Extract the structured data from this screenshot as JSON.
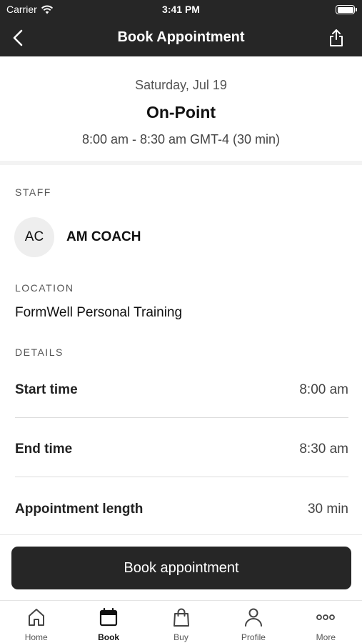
{
  "status_bar": {
    "carrier": "Carrier",
    "time": "3:41 PM"
  },
  "nav": {
    "title": "Book Appointment",
    "back_icon": "chevron-left-icon",
    "share_icon": "share-icon"
  },
  "header": {
    "date": "Saturday, Jul 19",
    "title": "On-Point",
    "time_range": "8:00 am - 8:30 am GMT-4 (30 min)"
  },
  "staff": {
    "label": "STAFF",
    "initials": "AC",
    "name": "AM COACH"
  },
  "location": {
    "label": "LOCATION",
    "value": "FormWell Personal Training"
  },
  "details": {
    "label": "DETAILS",
    "rows": [
      {
        "label": "Start time",
        "value": "8:00 am"
      },
      {
        "label": "End time",
        "value": "8:30 am"
      },
      {
        "label": "Appointment length",
        "value": "30 min"
      }
    ]
  },
  "cta": {
    "label": "Book appointment"
  },
  "colors": {
    "dark": "#262626",
    "divider": "#dddddd",
    "avatar_bg": "#eeeeee"
  },
  "tabs": [
    {
      "label": "Home",
      "icon": "home-icon",
      "active": false
    },
    {
      "label": "Book",
      "icon": "calendar-icon",
      "active": true
    },
    {
      "label": "Buy",
      "icon": "shopping-bag-icon",
      "active": false
    },
    {
      "label": "Profile",
      "icon": "person-icon",
      "active": false
    },
    {
      "label": "More",
      "icon": "more-dots-icon",
      "active": false
    }
  ]
}
